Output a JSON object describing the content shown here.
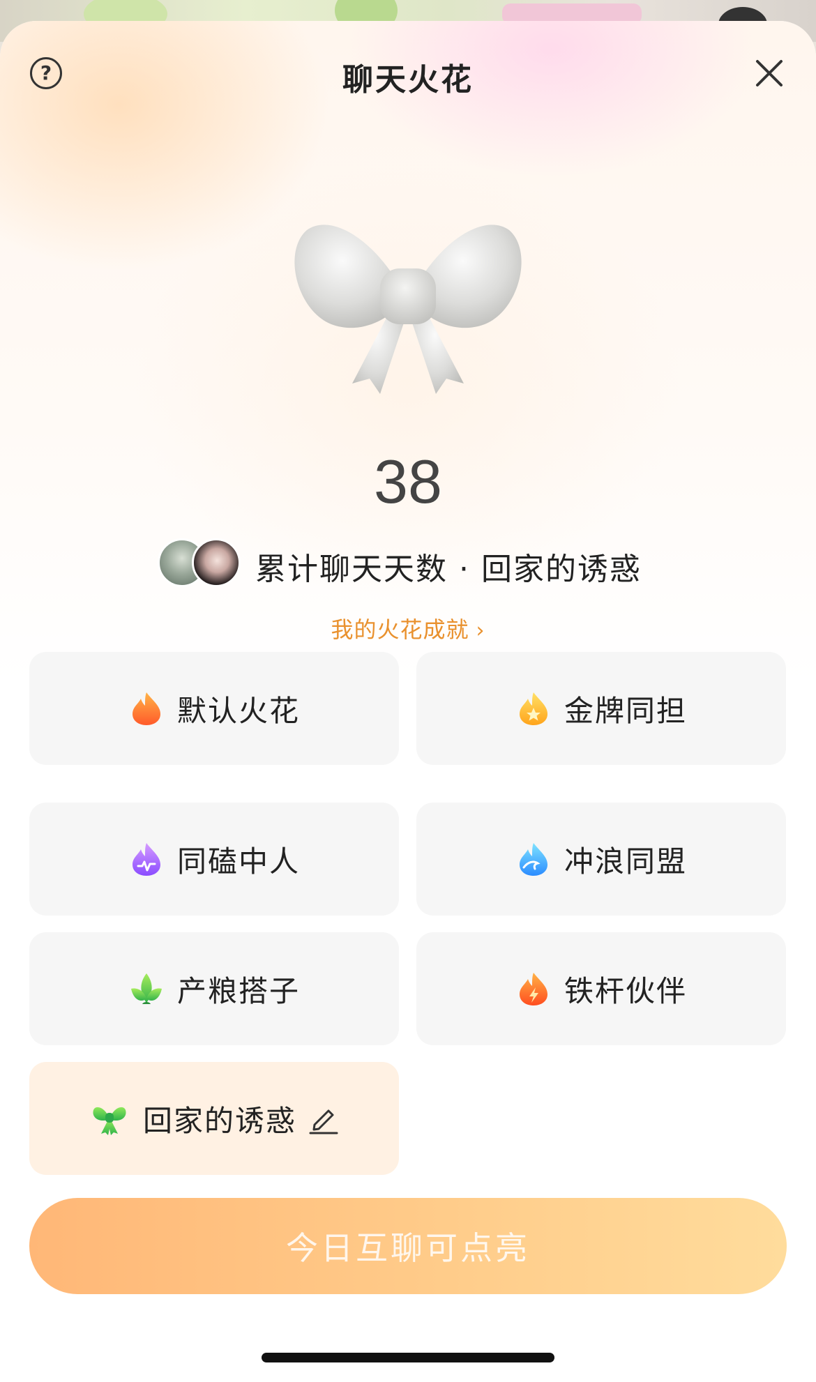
{
  "header": {
    "title": "聊天火花",
    "help_label": "?"
  },
  "spark": {
    "count": "38",
    "caption": "累计聊天天数 · 回家的诱惑"
  },
  "achievement_link": {
    "label": "我的火花成就",
    "chevron": "›"
  },
  "options": [
    {
      "label": "默认火花",
      "icon": "flame-orange-icon"
    },
    {
      "label": "金牌同担",
      "icon": "flame-star-icon"
    },
    {
      "label": "同磕中人",
      "icon": "flame-purple-icon"
    },
    {
      "label": "冲浪同盟",
      "icon": "flame-wave-icon"
    },
    {
      "label": "产粮搭子",
      "icon": "leaf-icon"
    },
    {
      "label": "铁杆伙伴",
      "icon": "flame-bolt-icon"
    },
    {
      "label": "回家的诱惑",
      "icon": "bow-icon",
      "selected": true
    }
  ],
  "cta": {
    "label": "今日互聊可点亮"
  },
  "colors": {
    "accent": "#e9912e",
    "cta_start": "#ffb777",
    "cta_end": "#ffdc9c",
    "selected_bg": "#fff1e3"
  }
}
